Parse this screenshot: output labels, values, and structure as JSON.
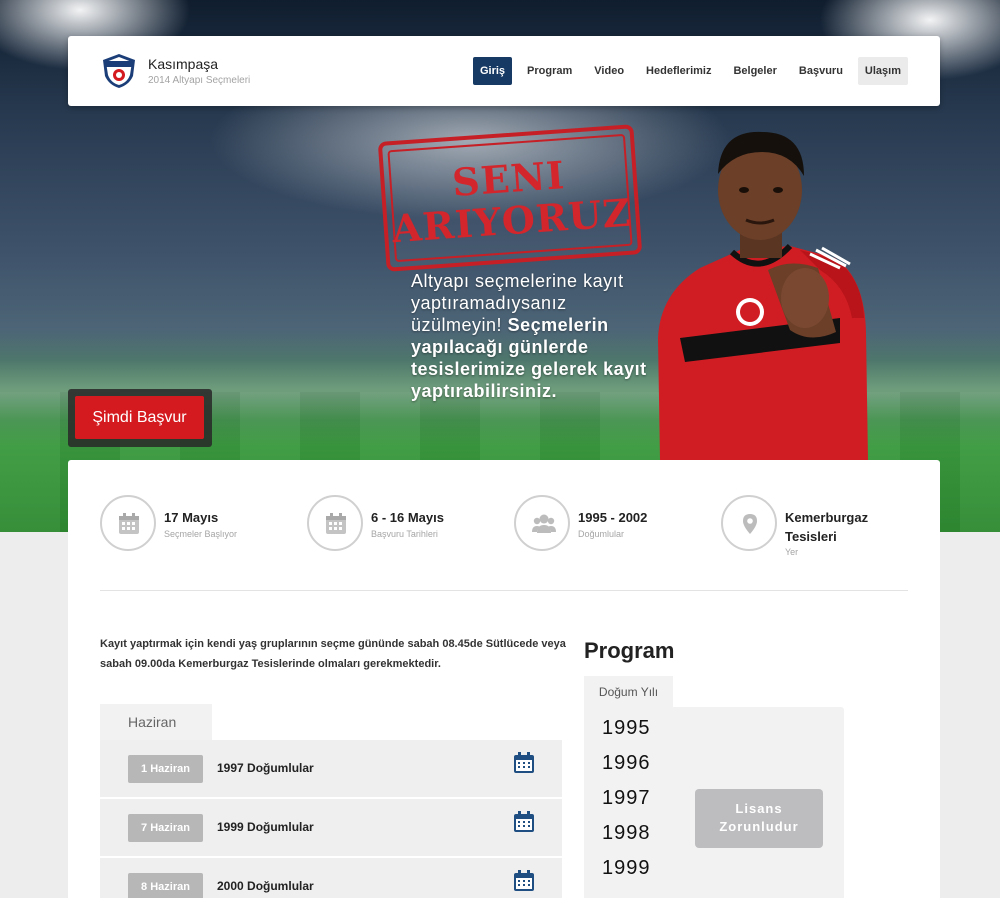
{
  "brand": {
    "name": "Kasımpaşa",
    "subtitle": "2014 Altyapı Seçmeleri",
    "logo_text": "KASIMPAŞA"
  },
  "nav": {
    "items": [
      "Giriş",
      "Program",
      "Video",
      "Hedeflerimiz",
      "Belgeler",
      "Başvuru",
      "Ulaşım"
    ],
    "active": "Giriş"
  },
  "hero": {
    "stamp_line1": "SENI",
    "stamp_line2": "ARIYORUZ",
    "text_thin": "Altyapı seçmelerine kayıt yaptıramadıysanız üzülmeyin!",
    "text_bold": "Seçmelerin yapılacağı günlerde tesislerimize gelerek kayıt yaptırabilirsiniz.",
    "cta_label": "Şimdi Başvur"
  },
  "stats": [
    {
      "icon": "calendar-icon",
      "title": "17 Mayıs",
      "subtitle": "Seçmeler Başlıyor"
    },
    {
      "icon": "calendar-icon",
      "title": "6 - 16 Mayıs",
      "subtitle": "Başvuru Tarihleri"
    },
    {
      "icon": "users-icon",
      "title": "1995 - 2002",
      "subtitle": "Doğumlular"
    },
    {
      "icon": "location-pin-icon",
      "title": "Kemerburgaz Tesisleri",
      "subtitle": "Yer"
    }
  ],
  "intro": "Kayıt yaptırmak için kendi yaş gruplarının seçme gününde sabah 08.45de Sütlücede veya sabah 09.00da Kemerburgaz Tesislerinde olmaları gerekmektedir.",
  "schedule": {
    "month_tab": "Haziran",
    "rows": [
      {
        "date": "1 Haziran",
        "label": "1997 Doğumlular"
      },
      {
        "date": "7 Haziran",
        "label": "1999 Doğumlular"
      },
      {
        "date": "8 Haziran",
        "label": "2000 Doğumlular"
      }
    ]
  },
  "program": {
    "title": "Program",
    "tab": "Doğum Yılı",
    "years": [
      "1995",
      "1996",
      "1997",
      "1998",
      "1999"
    ],
    "license_label": "Lisans Zorunludur"
  },
  "colors": {
    "accent_navy": "#173a64",
    "cta_red": "#d41a1f",
    "stamp_red": "#c62026"
  }
}
